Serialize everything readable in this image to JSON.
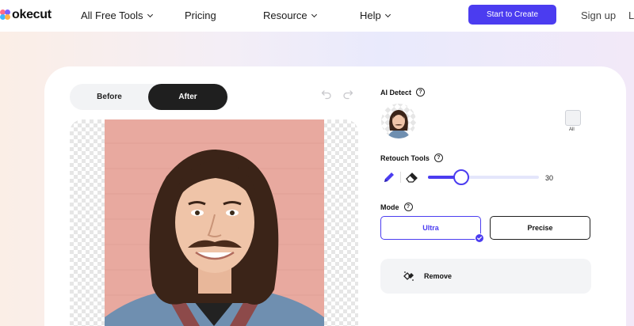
{
  "nav": {
    "logo_text": "okecut",
    "items": [
      {
        "label": "All Free Tools",
        "has_dropdown": true
      },
      {
        "label": "Pricing",
        "has_dropdown": false
      },
      {
        "label": "Resource",
        "has_dropdown": true
      },
      {
        "label": "Help",
        "has_dropdown": true
      }
    ],
    "cta_label": "Start to Create",
    "signup_label": "Sign up",
    "login_partial": "L"
  },
  "editor": {
    "toggle": {
      "before_label": "Before",
      "after_label": "After",
      "selected": "After"
    }
  },
  "panel": {
    "ai_detect": {
      "label": "AI Detect",
      "all_label": "All",
      "all_checked": false
    },
    "retouch": {
      "label": "Retouch Tools",
      "value": 30,
      "min": 0,
      "max": 100,
      "active_tool": "pen"
    },
    "mode": {
      "label": "Mode",
      "options": [
        "Ultra",
        "Precise"
      ],
      "selected": "Ultra"
    },
    "remove_label": "Remove"
  },
  "colors": {
    "accent": "#4b3cf0",
    "dark_button": "#1f1f1f",
    "photo_background": "#e8a99f"
  }
}
